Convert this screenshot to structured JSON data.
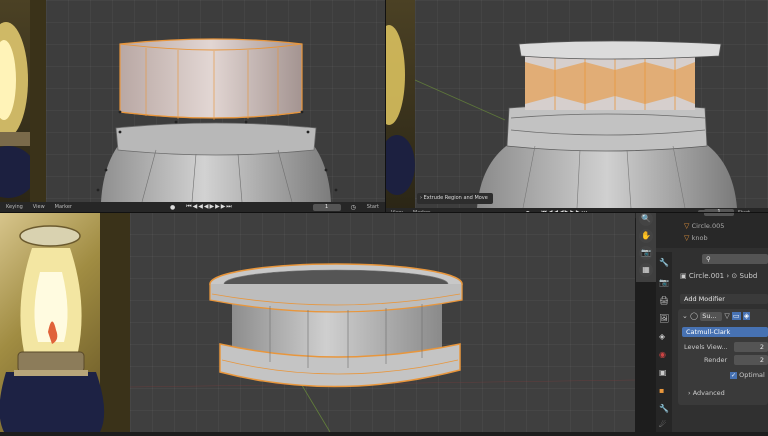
{
  "top_left_timeline": {
    "labels": [
      "Keying",
      "View",
      "Marker"
    ],
    "frame": "1",
    "start_label": "Start"
  },
  "top_right_timeline": {
    "labels": [
      "View",
      "Marker"
    ],
    "frame": "1",
    "start_label": "Start"
  },
  "operator_panel": {
    "label": "Extrude Region and Move"
  },
  "outliner": {
    "items": [
      {
        "name": "Circle.005"
      },
      {
        "name": "knob"
      }
    ]
  },
  "properties": {
    "object_name": "Circle.001",
    "modifier_tab_short": "Subd",
    "add_modifier_label": "Add Modifier",
    "modifier_name_short": "Su...",
    "subdiv_type": "Catmull-Clark",
    "levels_viewport_label": "Levels View...",
    "levels_viewport_value": "2",
    "render_label": "Render",
    "render_value": "2",
    "optimal_label": "Optimal",
    "advanced_label": "Advanced"
  },
  "colors": {
    "selection": "#e8963c",
    "viewport": "#3d3d3d",
    "blue_active": "#4772b3"
  }
}
